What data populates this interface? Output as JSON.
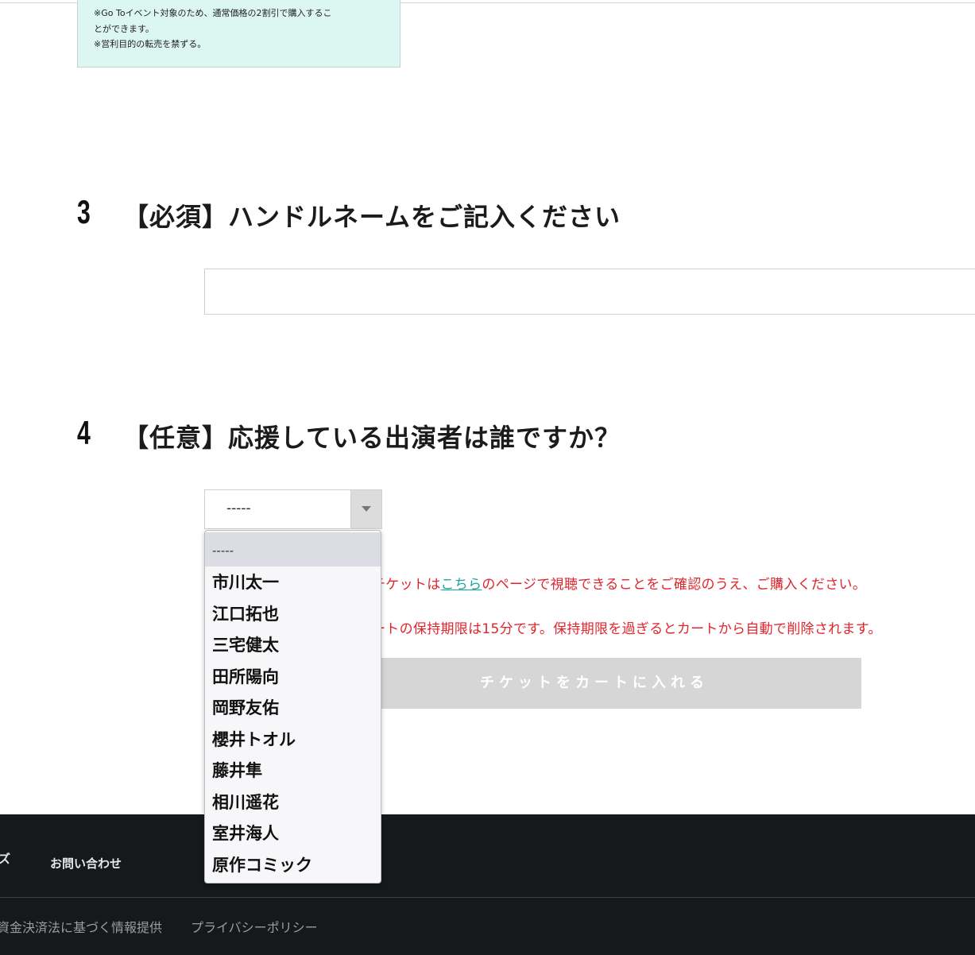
{
  "notice": {
    "line1": "※Go Toイベント対象のため、通常価格の2割引で購入するこ",
    "line2": "とができます。",
    "line3": "※営利目的の転売を禁ずる。"
  },
  "question3": {
    "number": "3",
    "title": "【必須】ハンドルネームをご記入ください",
    "input_value": ""
  },
  "question4": {
    "number": "4",
    "title": "【任意】応援している出演者は誰ですか？",
    "selected": "-----",
    "options": [
      "-----",
      "市川太一",
      "江口拓也",
      "三宅健太",
      "田所陽向",
      "岡野友佑",
      "櫻井トオル",
      "藤井隼",
      "相川遥花",
      "室井海人",
      "原作コミック"
    ]
  },
  "notices": {
    "viewing_pre": "チケットは",
    "viewing_link": "こちら",
    "viewing_post": "のページで視聴できることをご確認のうえ、ご購入ください。",
    "cart_limit": "ートの保持期限は15分です。保持期限を過ぎるとカートから自動で削除されます。"
  },
  "cart_button": "チケットをカートに入れる",
  "footer": {
    "partial_left": "ズ",
    "contact": "お問い合わせ",
    "payment_info": "資金決済法に基づく情報提供",
    "privacy": "プライバシーポリシー"
  },
  "colors": {
    "notice_bg": "#dcf6f2",
    "alert_red": "#e0242c",
    "link_teal": "#1aa49e",
    "button_disabled": "#d6d6d6",
    "footer_bg": "#15191b"
  }
}
